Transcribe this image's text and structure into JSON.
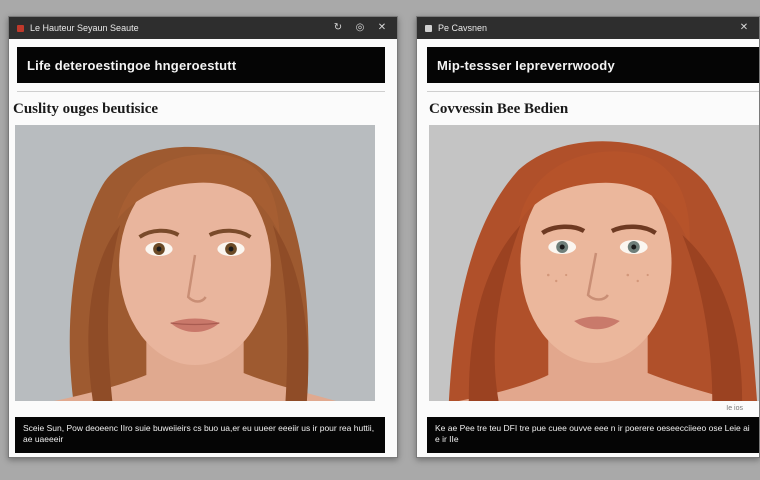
{
  "left": {
    "window_title": "Le Hauteur Seyaun Seaute",
    "header": "Life deteroestingoe hngeroestutt",
    "subtitle": "Cuslity ouges beutisice",
    "caption": "Sceie Sun, Pow deoeenc IIro suie buweiieirs cs buo ua,er eu uueer eeeiir us ir pour rea huttii, ae uaeeeir",
    "colors": {
      "skin": "#e8b49c",
      "hair": "#a4592f",
      "bg": "#b9bdc0",
      "eye": "#6b4a26"
    }
  },
  "right": {
    "window_title": "Pe Cavsnen",
    "header": "Mip-tessser Iepreverrwoody",
    "subtitle": "Covvessin Bee Bedien",
    "meta": "Ie ios",
    "caption": "Ke ae Pee tre teu DFI tre pue cuee ouvve eee n ir poerere oeseecciieeo ose Leie ai e ir IIe",
    "colors": {
      "skin": "#eab59a",
      "hair": "#b8532a",
      "bg": "#c4c4c4",
      "eye": "#6f7f7a"
    }
  },
  "icons": [
    "app-icon",
    "refresh-icon",
    "settings-icon",
    "close-icon"
  ]
}
